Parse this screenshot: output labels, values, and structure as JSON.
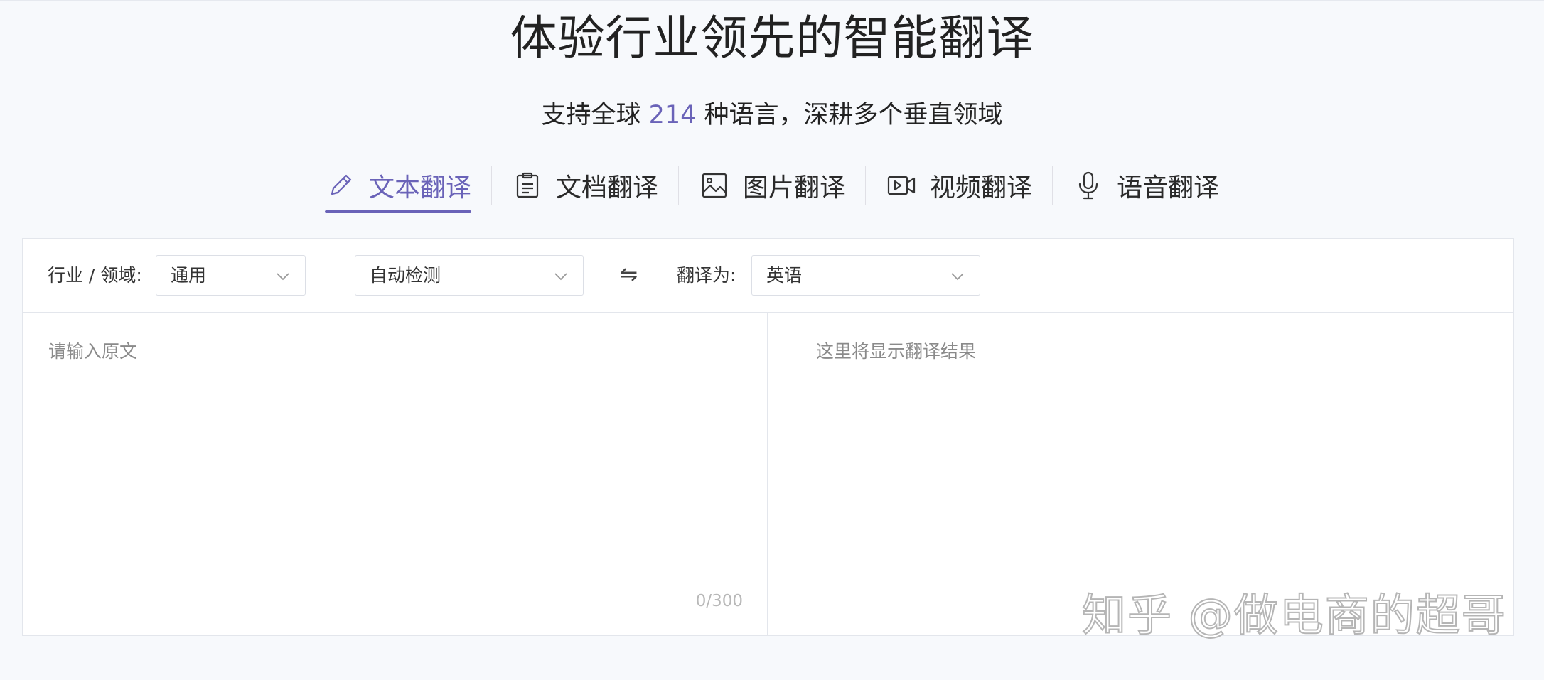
{
  "header": {
    "title": "体验行业领先的智能翻译",
    "subtitle_pre": "支持全球 ",
    "subtitle_num": "214",
    "subtitle_post": " 种语言，深耕多个垂直领域"
  },
  "tabs": [
    {
      "label": "文本翻译",
      "icon": "pencil-icon",
      "active": true
    },
    {
      "label": "文档翻译",
      "icon": "document-icon",
      "active": false
    },
    {
      "label": "图片翻译",
      "icon": "image-icon",
      "active": false
    },
    {
      "label": "视频翻译",
      "icon": "video-icon",
      "active": false
    },
    {
      "label": "语音翻译",
      "icon": "microphone-icon",
      "active": false
    }
  ],
  "toolbar": {
    "domain_label": "行业 / 领域:",
    "domain_value": "通用",
    "source_value": "自动检测",
    "swap_glyph": "⇋",
    "target_label": "翻译为:",
    "target_value": "英语"
  },
  "editor": {
    "source_placeholder": "请输入原文",
    "counter": "0/300",
    "result_placeholder": "这里将显示翻译结果"
  },
  "watermark": "知乎 @做电商的超哥",
  "colors": {
    "accent": "#6a63b8",
    "border": "#e3e6ec",
    "background": "#f7f9fc"
  }
}
